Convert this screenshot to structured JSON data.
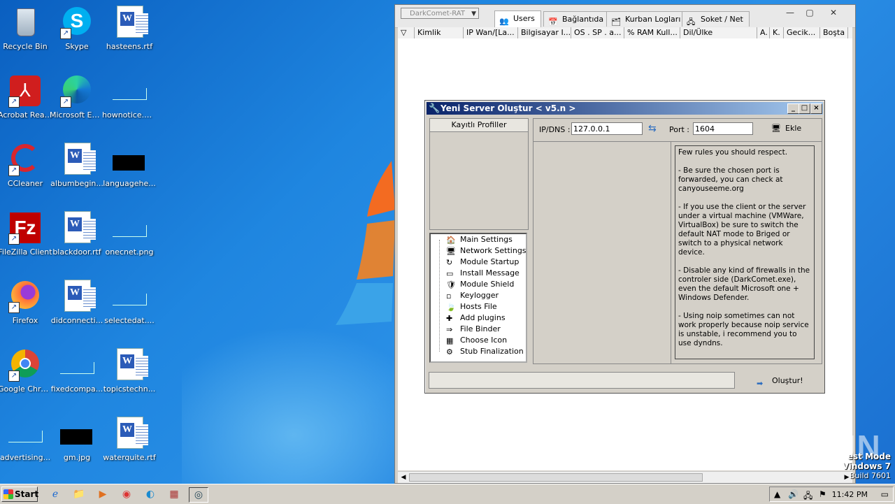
{
  "desktop": {
    "icons": [
      {
        "label": "Recycle Bin",
        "icon": "recycle-bin-icon"
      },
      {
        "label": "Skype",
        "icon": "skype-icon"
      },
      {
        "label": "hasteens.rtf",
        "icon": "word-document-icon"
      },
      {
        "label": "Acrobat Reader DC",
        "icon": "acrobat-icon"
      },
      {
        "label": "Microsoft Edge",
        "icon": "edge-icon"
      },
      {
        "label": "hownotice.png",
        "icon": "image-file-icon"
      },
      {
        "label": "CCleaner",
        "icon": "ccleaner-icon"
      },
      {
        "label": "albumbegin...",
        "icon": "word-document-icon"
      },
      {
        "label": "languagehe...",
        "icon": "image-file-icon"
      },
      {
        "label": "FileZilla Client",
        "icon": "filezilla-icon"
      },
      {
        "label": "blackdoor.rtf",
        "icon": "word-document-icon"
      },
      {
        "label": "onecnet.png",
        "icon": "image-file-icon"
      },
      {
        "label": "Firefox",
        "icon": "firefox-icon"
      },
      {
        "label": "didconnecti...",
        "icon": "word-document-icon"
      },
      {
        "label": "selectedat....",
        "icon": "image-file-icon"
      },
      {
        "label": "Google Chrome",
        "icon": "chrome-icon"
      },
      {
        "label": "fixedcompa...",
        "icon": "image-file-icon"
      },
      {
        "label": "topicstechn...",
        "icon": "word-document-icon"
      },
      {
        "label": "advertising...",
        "icon": "image-file-icon"
      },
      {
        "label": "gm.jpg",
        "icon": "image-file-icon"
      },
      {
        "label": "waterquite.rtf",
        "icon": "word-document-icon"
      }
    ]
  },
  "rat_window": {
    "select_value": "DarkComet-RAT",
    "tabs": [
      {
        "label": "Users",
        "icon": "users-icon"
      },
      {
        "label": "Bağlantıda",
        "icon": "calendar-icon"
      },
      {
        "label": "Kurban Logları",
        "icon": "log-icon"
      },
      {
        "label": "Soket / Net",
        "icon": "network-icon"
      }
    ],
    "columns": [
      "",
      "Kimlik",
      "IP Wan/[La...",
      "Bilgisayar I...",
      "OS . SP . a...",
      "% RAM Kull...",
      "Dil/Ülke",
      "A.",
      "K.",
      "Gecik...",
      "Boşta"
    ]
  },
  "dialog": {
    "title": "Yeni Server Oluştur < v5.n >",
    "profiles_header": "Kayıtlı Profiller",
    "ip_label": "IP/DNS :",
    "ip_value": "127.0.0.1",
    "port_label": "Port :",
    "port_value": "1604",
    "add_label": "Ekle",
    "rules_text": "Few rules you should respect.\n\n- Be sure the chosen port is forwarded, you can check at canyouseeme.org\n\n- If you use the client or the server under a virtual machine (VMWare, VirtualBox) be sure to switch the default NAT mode to Briged or switch to a physical network device.\n\n- Disable any kind of firewalls in the controler side (DarkComet.exe), even the default Microsoft one + Windows Defender.\n\n- Using noip sometimes can not work properly because noip service is unstable, i recommend you to use dyndns.",
    "tree": [
      {
        "label": "Main Settings",
        "icon": "house-icon"
      },
      {
        "label": "Network Settings",
        "icon": "monitor-icon"
      },
      {
        "label": "Module Startup",
        "icon": "startup-icon"
      },
      {
        "label": "Install Message",
        "icon": "message-icon"
      },
      {
        "label": "Module Shield",
        "icon": "shield-icon"
      },
      {
        "label": "Keylogger",
        "icon": "keyboard-icon"
      },
      {
        "label": "Hosts File",
        "icon": "leaf-icon"
      },
      {
        "label": "Add plugins",
        "icon": "puzzle-icon"
      },
      {
        "label": "File Binder",
        "icon": "binder-icon"
      },
      {
        "label": "Choose Icon",
        "icon": "image-icon"
      },
      {
        "label": "Stub Finalization",
        "icon": "stub-icon"
      }
    ],
    "progress": 0,
    "create_label": "Oluştur!"
  },
  "test_mode": {
    "line1": "est Mode",
    "line2": "Vindows 7",
    "line3": "Build 7601"
  },
  "watermark": "ANY RUN",
  "taskbar": {
    "start_label": "Start",
    "clock": "11:42 PM"
  }
}
